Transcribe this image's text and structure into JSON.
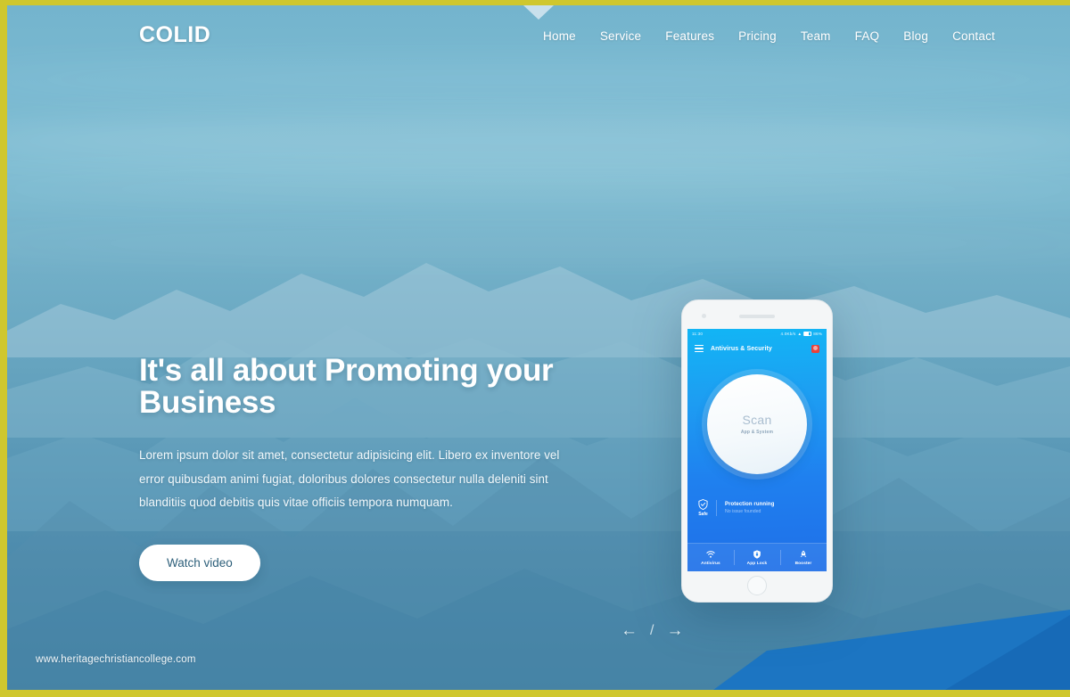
{
  "brand": {
    "name": "COLID"
  },
  "nav": {
    "items": [
      {
        "label": "Home"
      },
      {
        "label": "Service"
      },
      {
        "label": "Features"
      },
      {
        "label": "Pricing"
      },
      {
        "label": "Team"
      },
      {
        "label": "FAQ"
      },
      {
        "label": "Blog"
      },
      {
        "label": "Contact"
      }
    ]
  },
  "hero": {
    "title": "It's all about Promoting your Business",
    "description": "Lorem ipsum dolor sit amet, consectetur adipisicing elit. Libero ex inventore vel error quibusdam animi fugiat, doloribus dolores consectetur nulla deleniti sint blanditiis quod debitis quis vitae officiis tempora numquam.",
    "cta_label": "Watch video"
  },
  "slider": {
    "prev_glyph": "←",
    "divider": "/",
    "next_glyph": "→"
  },
  "watermark": {
    "text": "www.heritagechristiancollege.com"
  },
  "scroll_indicator": {
    "name": "chevron-down-icon"
  },
  "phone": {
    "status_bar": {
      "time": "11:30",
      "carrier": "4.0Kb/s",
      "battery": "86%"
    },
    "app_bar": {
      "title": "Antivirus & Security",
      "menu_icon": "hamburger-icon",
      "badge_icon": "alert-badge-icon"
    },
    "scan": {
      "label": "Scan",
      "sublabel": "App & System"
    },
    "status": {
      "shield_label": "Safe",
      "title": "Protection running",
      "subtitle": "No issue founded"
    },
    "tabs": [
      {
        "label": "Antivirus",
        "icon": "wifi-icon"
      },
      {
        "label": "App Lock",
        "icon": "shield-lock-icon"
      },
      {
        "label": "Booster",
        "icon": "rocket-icon"
      }
    ]
  },
  "colors": {
    "frame_gold": "#cfc72e",
    "sky_top": "#74b4cd",
    "sky_bottom": "#4281a4",
    "phone_accent": "#1f80ef",
    "cta_text": "#2d5f7a",
    "badge_red": "#e8413a",
    "bottom_shape": "#1974c4"
  }
}
